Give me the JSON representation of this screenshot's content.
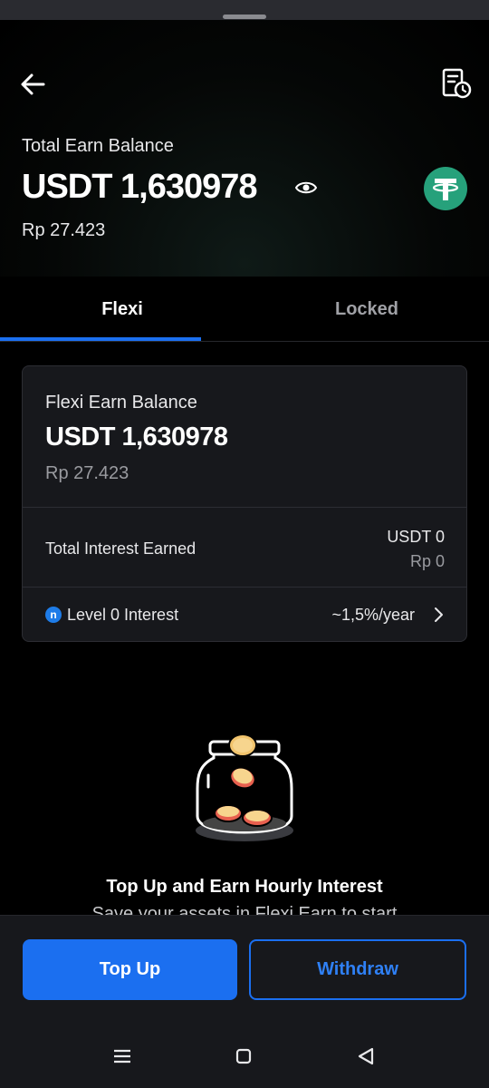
{
  "header": {
    "total_label": "Total Earn Balance",
    "total_value": "USDT 1,630978",
    "total_idr": "Rp 27.423",
    "accent_color": "#26a17b"
  },
  "tabs": [
    {
      "label": "Flexi",
      "active": true
    },
    {
      "label": "Locked",
      "active": false
    }
  ],
  "card": {
    "balance_label": "Flexi Earn Balance",
    "balance_value": "USDT 1,630978",
    "balance_idr": "Rp 27.423",
    "interest_label": "Total Interest Earned",
    "interest_usdt": "USDT 0",
    "interest_idr": "Rp 0",
    "level_label": "Level 0 Interest",
    "level_rate": "~1,5%/year"
  },
  "empty_state": {
    "title": "Top Up and Earn Hourly Interest",
    "description": "Save your assets in Flexi Earn to start"
  },
  "actions": {
    "topup_label": "Top Up",
    "withdraw_label": "Withdraw"
  },
  "icons": [
    "arrow-left-icon",
    "history-icon",
    "eye-icon",
    "tether-logo-icon",
    "level-badge-icon",
    "chevron-right-icon",
    "jar-illustration",
    "menu-icon",
    "home-icon",
    "back-triangle-icon"
  ],
  "colors": {
    "primary": "#1b6ff0",
    "background": "#000000",
    "card": "#17181c"
  }
}
